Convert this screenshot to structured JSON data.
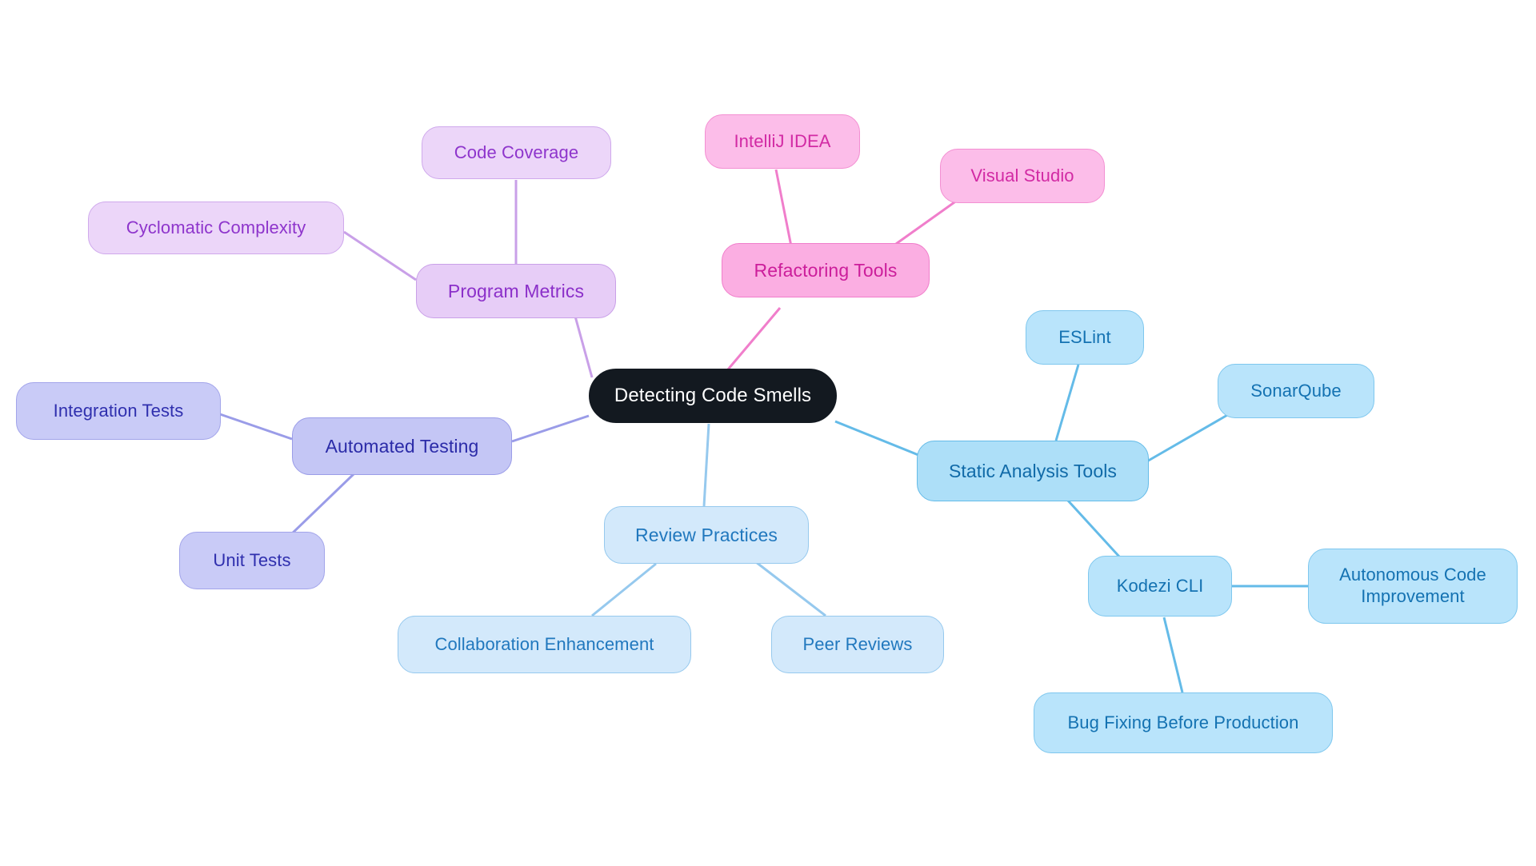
{
  "diagram": {
    "type": "mindmap",
    "title": "Detecting Code Smells",
    "background_color": "#ffffff",
    "root": {
      "id": "root",
      "label": "Detecting Code Smells",
      "fill": "#131920",
      "text_color": "#ffffff"
    },
    "branches": [
      {
        "id": "program-metrics",
        "label": "Program Metrics",
        "fill": "#e7cdf7",
        "stroke": "#c9a0e8",
        "text_color": "#8b2fc9",
        "children": [
          {
            "id": "cyclomatic-complexity",
            "label": "Cyclomatic Complexity"
          },
          {
            "id": "code-coverage",
            "label": "Code Coverage"
          }
        ]
      },
      {
        "id": "refactoring-tools",
        "label": "Refactoring Tools",
        "fill": "#fbaee2",
        "stroke": "#f07ecb",
        "text_color": "#cc1e9b",
        "children": [
          {
            "id": "intellij-idea",
            "label": "IntelliJ IDEA"
          },
          {
            "id": "visual-studio",
            "label": "Visual Studio"
          }
        ]
      },
      {
        "id": "static-analysis-tools",
        "label": "Static Analysis Tools",
        "fill": "#addff8",
        "stroke": "#64bbe8",
        "text_color": "#106aa8",
        "children": [
          {
            "id": "eslint",
            "label": "ESLint"
          },
          {
            "id": "sonarqube",
            "label": "SonarQube"
          },
          {
            "id": "kodezi-cli",
            "label": "Kodezi CLI",
            "children": [
              {
                "id": "autonomous-code-improvement",
                "label": "Autonomous Code\nImprovement"
              },
              {
                "id": "bug-fixing-before-production",
                "label": "Bug Fixing Before Production"
              }
            ]
          }
        ]
      },
      {
        "id": "review-practices",
        "label": "Review Practices",
        "fill": "#d3e9fb",
        "stroke": "#96c9ee",
        "text_color": "#2178be",
        "children": [
          {
            "id": "collaboration-enhancement",
            "label": "Collaboration Enhancement"
          },
          {
            "id": "peer-reviews",
            "label": "Peer Reviews"
          }
        ]
      },
      {
        "id": "automated-testing",
        "label": "Automated Testing",
        "fill": "#c4c6f5",
        "stroke": "#9a9ce8",
        "text_color": "#2b2ba8",
        "children": [
          {
            "id": "integration-tests",
            "label": "Integration Tests"
          },
          {
            "id": "unit-tests",
            "label": "Unit Tests"
          }
        ]
      }
    ],
    "nodes": {
      "root": "Detecting Code Smells",
      "code_coverage": "Code Coverage",
      "cyclomatic_complexity": "Cyclomatic Complexity",
      "program_metrics": "Program Metrics",
      "intellij_idea": "IntelliJ IDEA",
      "visual_studio": "Visual Studio",
      "refactoring_tools": "Refactoring Tools",
      "eslint": "ESLint",
      "sonarqube": "SonarQube",
      "static_analysis_tools": "Static Analysis Tools",
      "kodezi_cli": "Kodezi CLI",
      "autonomous_code_improvement": "Autonomous Code\nImprovement",
      "bug_fixing_before_production": "Bug Fixing Before Production",
      "review_practices": "Review Practices",
      "collaboration_enhancement": "Collaboration Enhancement",
      "peer_reviews": "Peer Reviews",
      "integration_tests": "Integration Tests",
      "automated_testing": "Automated Testing",
      "unit_tests": "Unit Tests"
    },
    "edge_colors": {
      "purple": "#c9a0e8",
      "pink": "#f07ecb",
      "blue": "#64bbe8",
      "blue_light": "#96c9ee",
      "indigo": "#9a9ce8"
    }
  }
}
